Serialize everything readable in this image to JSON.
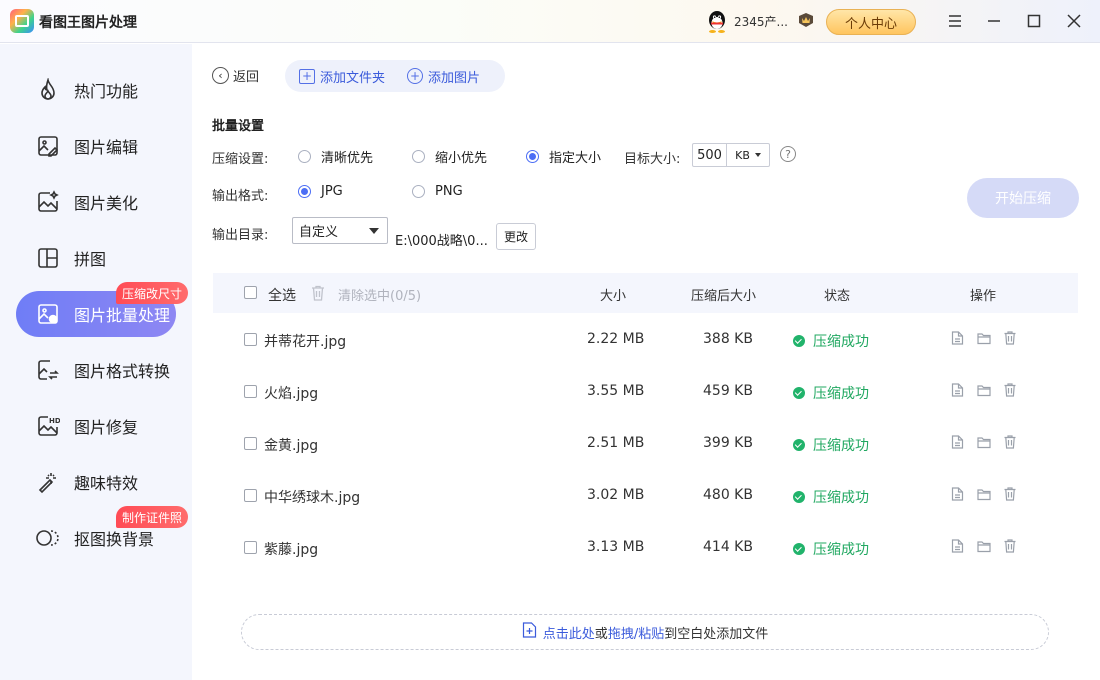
{
  "app": {
    "title": "看图王图片处理"
  },
  "header": {
    "user": "2345产...",
    "center_label": "个人中心"
  },
  "sidebar": {
    "items": [
      {
        "label": "热门功能",
        "icon": "fire-icon"
      },
      {
        "label": "图片编辑",
        "icon": "image-edit-icon"
      },
      {
        "label": "图片美化",
        "icon": "image-beautify-icon"
      },
      {
        "label": "拼图",
        "icon": "collage-icon"
      },
      {
        "label": "图片批量处理",
        "icon": "batch-image-icon",
        "active": true,
        "tag": "压缩改尺寸"
      },
      {
        "label": "图片格式转换",
        "icon": "format-convert-icon"
      },
      {
        "label": "图片修复",
        "icon": "hd-repair-icon"
      },
      {
        "label": "趣味特效",
        "icon": "magic-wand-icon"
      },
      {
        "label": "抠图换背景",
        "icon": "cutout-icon",
        "tag": "制作证件照"
      }
    ]
  },
  "toolbar": {
    "back": "返回",
    "add_folder": "添加文件夹",
    "add_image": "添加图片"
  },
  "settings": {
    "section_title": "批量设置",
    "compress_label": "压缩设置:",
    "compress_options": [
      "清晰优先",
      "缩小优先",
      "指定大小"
    ],
    "compress_selected": "指定大小",
    "target_label": "目标大小:",
    "target_value": "500",
    "target_unit": "KB",
    "format_label": "输出格式:",
    "format_options": [
      "JPG",
      "PNG"
    ],
    "format_selected": "JPG",
    "dir_label": "输出目录:",
    "dir_mode": "自定义",
    "dir_path": "E:\\000战略\\0...",
    "change_label": "更改",
    "start_label": "开始压缩"
  },
  "table": {
    "select_all": "全选",
    "clear_selected": "清除选中(0/5)",
    "columns": {
      "size": "大小",
      "compressed": "压缩后大小",
      "status": "状态",
      "actions": "操作"
    },
    "rows": [
      {
        "name": "并蒂花开.jpg",
        "size": "2.22 MB",
        "compressed": "388 KB",
        "status": "压缩成功"
      },
      {
        "name": "火焰.jpg",
        "size": "3.55 MB",
        "compressed": "459 KB",
        "status": "压缩成功"
      },
      {
        "name": "金黄.jpg",
        "size": "2.51 MB",
        "compressed": "399 KB",
        "status": "压缩成功"
      },
      {
        "name": "中华绣球木.jpg",
        "size": "3.02 MB",
        "compressed": "480 KB",
        "status": "压缩成功"
      },
      {
        "name": "紫藤.jpg",
        "size": "3.13 MB",
        "compressed": "414 KB",
        "status": "压缩成功"
      }
    ]
  },
  "dropzone": {
    "part1": "点击此处",
    "part2": "或",
    "part3": "拖拽/粘贴",
    "part4": "到空白处添加文件"
  },
  "colors": {
    "accent": "#4c6ef5",
    "success": "#21a861",
    "tag": "#ff4b55"
  }
}
